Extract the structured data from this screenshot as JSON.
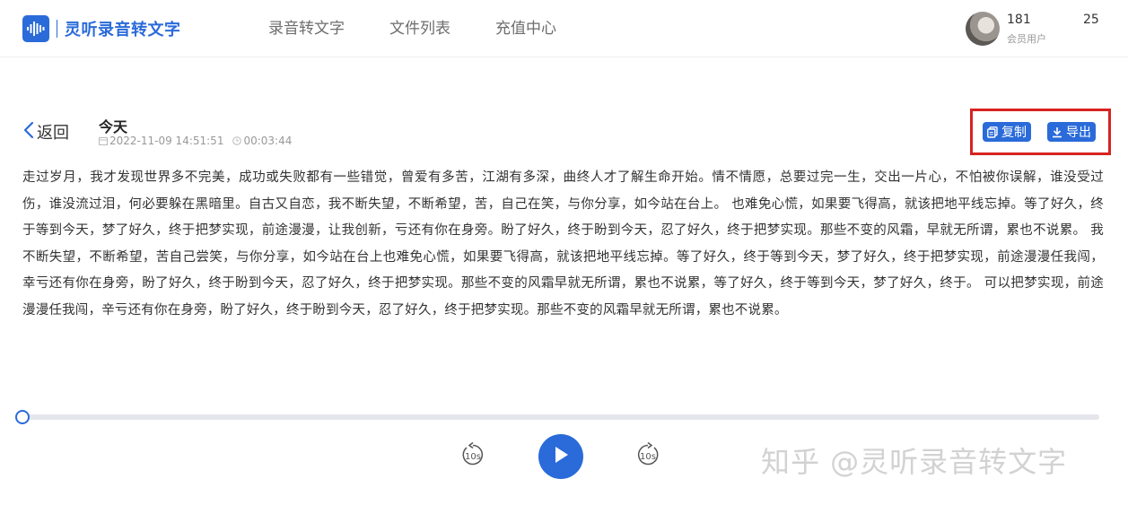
{
  "header": {
    "logo_text": "灵听录音转文字",
    "nav": [
      {
        "label": "录音转文字"
      },
      {
        "label": "文件列表"
      },
      {
        "label": "充值中心"
      }
    ],
    "user": {
      "name": "181",
      "extra": "25",
      "role": "会员用户"
    }
  },
  "detail": {
    "back_label": "返回",
    "title": "今天",
    "date": "2022-11-09 14:51:51",
    "duration": "00:03:44",
    "copy_label": "复制",
    "export_label": "导出",
    "transcript": "走过岁月，我才发现世界多不完美，成功或失败都有一些错觉，曾爱有多苦，江湖有多深，曲终人才了解生命开始。情不情愿，总要过完一生，交出一片心，不怕被你误解，谁没受过伤，谁没流过泪，何必要躲在黑暗里。自古又自恋，我不断失望，不断希望，苦，自己在笑，与你分享，如今站在台上。 也难免心慌，如果要飞得高，就该把地平线忘掉。等了好久，终于等到今天，梦了好久，终于把梦实现，前途漫漫，让我创新，亏还有你在身旁。盼了好久，终于盼到今天，忍了好久，终于把梦实现。那些不变的风霜，早就无所谓，累也不说累。 我不断失望，不断希望，苦自己尝笑，与你分享，如今站在台上也难免心慌，如果要飞得高，就该把地平线忘掉。等了好久，终于等到今天，梦了好久，终于把梦实现，前途漫漫任我闯，幸亏还有你在身旁，盼了好久，终于盼到今天，忍了好久，终于把梦实现。那些不变的风霜早就无所谓，累也不说累，等了好久，终于等到今天，梦了好久，终于。 可以把梦实现，前途漫漫任我闯，辛亏还有你在身旁，盼了好久，终于盼到今天，忍了好久，终于把梦实现。那些不变的风霜早就无所谓，累也不说累。"
  },
  "player": {
    "progress": 0,
    "rewind_label": "10s",
    "forward_label": "10s"
  },
  "watermark": "知乎 @灵听录音转文字",
  "colors": {
    "accent": "#2a6bd9",
    "highlight": "#d7231f"
  }
}
